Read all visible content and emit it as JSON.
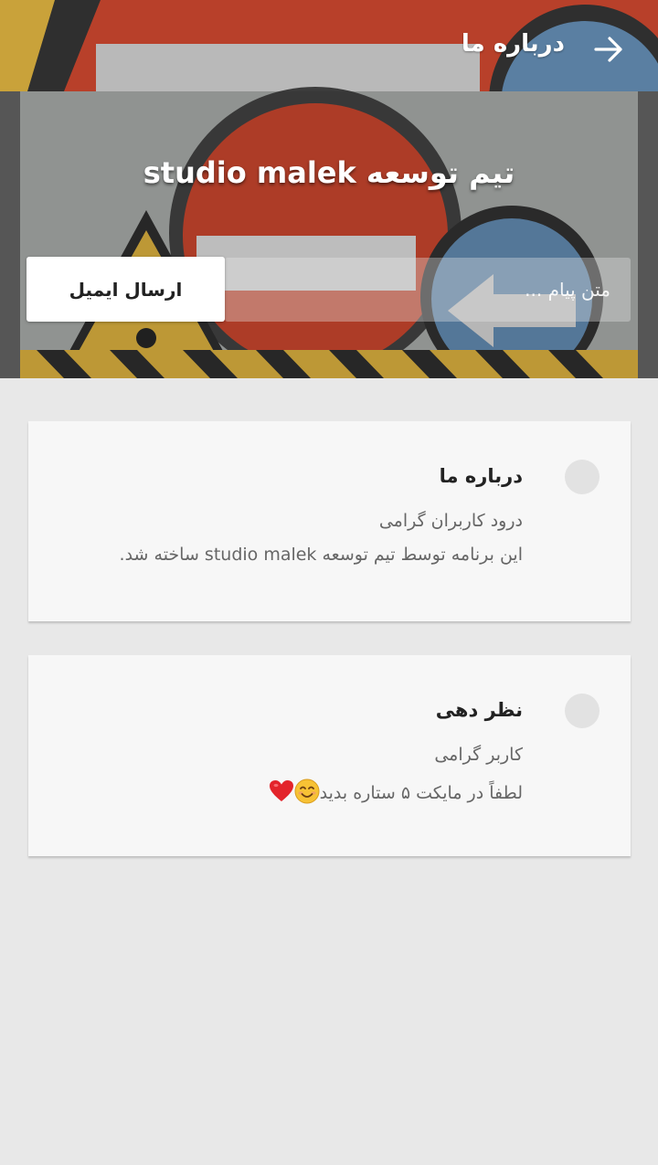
{
  "header": {
    "title": "درباره ما",
    "back_icon": "arrow-right-icon"
  },
  "hero": {
    "team_title": "تیم توسعه studio malek",
    "message_placeholder": "متن پیام ...",
    "send_button_label": "ارسال ایمیل"
  },
  "cards": [
    {
      "title": "درباره ما",
      "line1": "درود کاربران گرامی",
      "line2": "این برنامه توسط تیم توسعه studio malek ساخته شد."
    },
    {
      "title": "نظر دهی",
      "line1": "کاربر گرامی",
      "line2": "لطفاً در مایکت ۵ ستاره بدید",
      "emojis": [
        "smiling-face-icon",
        "red-heart-icon"
      ]
    }
  ],
  "colors": {
    "background": "#e8e8e8",
    "card": "#f7f7f7",
    "button": "#ffffff"
  }
}
